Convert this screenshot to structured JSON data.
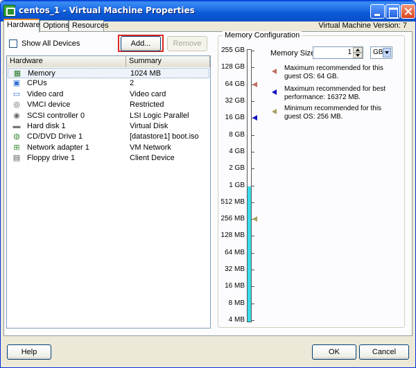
{
  "window": {
    "title": "centos_1 - Virtual Machine Properties",
    "vm_version": "Virtual Machine Version: 7"
  },
  "tabs": [
    {
      "label": "Hardware",
      "active": true
    },
    {
      "label": "Options",
      "active": false
    },
    {
      "label": "Resources",
      "active": false
    }
  ],
  "hardware_panel": {
    "show_all_devices_label": "Show All Devices",
    "show_all_devices_checked": false,
    "add_label": "Add...",
    "remove_label": "Remove",
    "columns": [
      "Hardware",
      "Summary"
    ],
    "rows": [
      {
        "icon": "memory-icon",
        "name": "Memory",
        "summary": "1024 MB",
        "selected": true
      },
      {
        "icon": "cpu-icon",
        "name": "CPUs",
        "summary": "2",
        "selected": false
      },
      {
        "icon": "video-card-icon",
        "name": "Video card",
        "summary": "Video card",
        "selected": false
      },
      {
        "icon": "vmci-device-icon",
        "name": "VMCI device",
        "summary": "Restricted",
        "selected": false
      },
      {
        "icon": "scsi-controller-icon",
        "name": "SCSI controller 0",
        "summary": "LSI Logic Parallel",
        "selected": false
      },
      {
        "icon": "hard-disk-icon",
        "name": "Hard disk 1",
        "summary": "Virtual Disk",
        "selected": false
      },
      {
        "icon": "cd-dvd-icon",
        "name": "CD/DVD Drive 1",
        "summary": "[datastore1] boot.iso",
        "selected": false
      },
      {
        "icon": "network-adapter-icon",
        "name": "Network adapter 1",
        "summary": "VM Network",
        "selected": false
      },
      {
        "icon": "floppy-drive-icon",
        "name": "Floppy drive 1",
        "summary": "Client Device",
        "selected": false
      }
    ]
  },
  "memory_config": {
    "title": "Memory Configuration",
    "size_label": "Memory Size:",
    "size_value": "1",
    "unit": "GB",
    "scale_labels": [
      "255 GB",
      "128 GB",
      "64 GB",
      "32 GB",
      "16 GB",
      "8 GB",
      "4 GB",
      "2 GB",
      "1 GB",
      "512 MB",
      "256 MB",
      "128 MB",
      "64 MB",
      "32 MB",
      "16 MB",
      "8 MB",
      "4 MB"
    ],
    "fill_to_label": "1 GB",
    "legend": [
      {
        "marker_color": "#c07060",
        "marker_icon": "max-recommended-marker-icon",
        "line1": "Maximum recommended for this",
        "line2": "guest OS: 64 GB.",
        "at_label": "64 GB"
      },
      {
        "marker_color": "#1010c0",
        "marker_icon": "best-performance-marker-icon",
        "line1": "Maximum recommended for best",
        "line2": "performance: 16372 MB.",
        "at_label": "16 GB"
      },
      {
        "marker_color": "#a8a060",
        "marker_icon": "min-recommended-marker-icon",
        "line1": "Minimum recommended for this",
        "line2": "guest OS: 256 MB.",
        "at_label": "256 MB"
      }
    ]
  },
  "footer": {
    "help_label": "Help",
    "ok_label": "OK",
    "cancel_label": "Cancel"
  }
}
